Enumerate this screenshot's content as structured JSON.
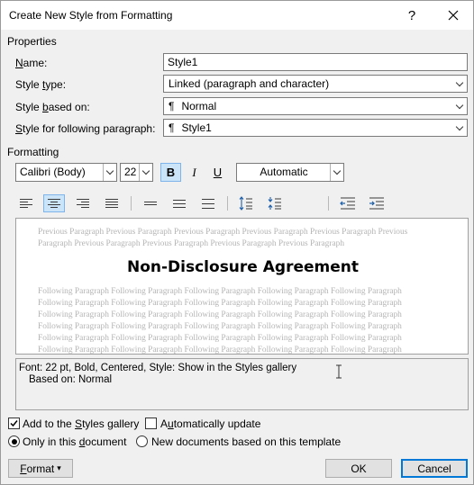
{
  "window": {
    "title": "Create New Style from Formatting",
    "help_icon": "?",
    "close_icon": "close-x"
  },
  "properties": {
    "section_label": "Properties",
    "name_label_pre": "",
    "name_label_ak": "N",
    "name_label_post": "ame:",
    "name_value": "Style1",
    "type_label_pre": "Style ",
    "type_label_ak": "t",
    "type_label_post": "ype:",
    "type_value": "Linked (paragraph and character)",
    "based_label_pre": "Style ",
    "based_label_ak": "b",
    "based_label_post": "ased on:",
    "based_value": "Normal",
    "following_label_pre": "",
    "following_label_ak": "S",
    "following_label_post": "tyle for following paragraph:",
    "following_value": "Style1",
    "pilcrow": "¶"
  },
  "formatting": {
    "section_label": "Formatting",
    "font": "Calibri (Body)",
    "size": "22",
    "bold": "B",
    "italic": "I",
    "underline": "U",
    "color": "Automatic"
  },
  "preview": {
    "previous_text": "Previous Paragraph Previous Paragraph Previous Paragraph Previous Paragraph Previous Paragraph Previous Paragraph Previous Paragraph Previous Paragraph Previous Paragraph Previous Paragraph",
    "title": "Non-Disclosure Agreement",
    "following_text": "Following Paragraph Following Paragraph Following Paragraph Following Paragraph Following Paragraph Following Paragraph Following Paragraph Following Paragraph Following Paragraph Following Paragraph Following Paragraph Following Paragraph Following Paragraph Following Paragraph Following Paragraph Following Paragraph Following Paragraph Following Paragraph Following Paragraph Following Paragraph Following Paragraph Following Paragraph Following Paragraph Following Paragraph Following Paragraph Following Paragraph Following Paragraph Following Paragraph Following Paragraph Following Paragraph Following Paragraph Following Paragraph Following Paragraph Following Paragraph Following Paragraph Following Paragraph"
  },
  "description": {
    "line1": "Font: 22 pt, Bold, Centered, Style: Show in the Styles gallery",
    "line2": "Based on: Normal"
  },
  "options": {
    "add_gallery_pre": "Add to the ",
    "add_gallery_ak": "S",
    "add_gallery_post": "tyles gallery",
    "add_gallery_checked": true,
    "auto_update_pre": "A",
    "auto_update_ak": "u",
    "auto_update_post": "tomatically update",
    "auto_update_checked": false,
    "only_doc_pre": "Only in this ",
    "only_doc_ak": "d",
    "only_doc_post": "ocument",
    "only_doc_selected": true,
    "new_docs": "New documents based on this template",
    "new_docs_selected": false
  },
  "buttons": {
    "format_ak": "F",
    "format_post": "ormat",
    "format_arrow": "▾",
    "ok": "OK",
    "cancel": "Cancel"
  },
  "colors": {
    "accent": "#0078d7",
    "active_fill": "#cce4f7",
    "active_border": "#7eb4ea"
  }
}
